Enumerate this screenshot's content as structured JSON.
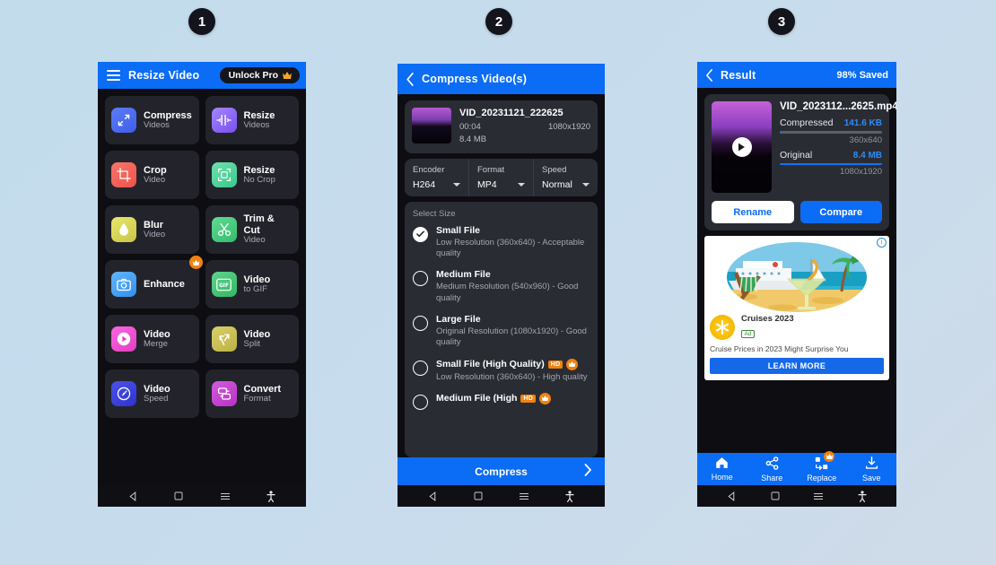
{
  "background": {
    "color_from": "#c2dcec",
    "color_to": "#cfdbe8"
  },
  "steps": [
    {
      "label": "1"
    },
    {
      "label": "2"
    },
    {
      "label": "3"
    }
  ],
  "screen1": {
    "appbar": {
      "title": "Resize Video",
      "menu_icon": "hamburger-icon",
      "unlock_label": "Unlock Pro",
      "crown_icon": "crown-icon"
    },
    "tiles": [
      {
        "title": "Compress",
        "subtitle": "Videos",
        "icon": "compress-arrows-icon",
        "color_from": "#5b7cf7",
        "color_to": "#3f5ee8",
        "pro": false
      },
      {
        "title": "Resize",
        "subtitle": "Videos",
        "icon": "resize-horizontal-icon",
        "color_from": "#a286fb",
        "color_to": "#7b4ff0",
        "pro": false
      },
      {
        "title": "Crop",
        "subtitle": "Video",
        "icon": "crop-icon",
        "color_from": "#f7766b",
        "color_to": "#ef5249",
        "pro": false
      },
      {
        "title": "Resize",
        "subtitle": "No Crop",
        "icon": "expand-frame-icon",
        "color_from": "#6fe0ac",
        "color_to": "#39c98c",
        "pro": false
      },
      {
        "title": "Blur",
        "subtitle": "Video",
        "icon": "droplet-icon",
        "color_from": "#e8e86a",
        "color_to": "#c9c447",
        "pro": false
      },
      {
        "title": "Trim & Cut",
        "subtitle": "Video",
        "icon": "scissors-icon",
        "color_from": "#63d993",
        "color_to": "#32bd6c",
        "pro": false
      },
      {
        "title": "Enhance",
        "subtitle": "",
        "icon": "camera-icon",
        "color_from": "#64b5fb",
        "color_to": "#2f90f0",
        "pro": true
      },
      {
        "title": "Video",
        "subtitle": "to GIF",
        "icon": "gif-icon",
        "color_from": "#5fd48c",
        "color_to": "#2fb865",
        "pro": false
      },
      {
        "title": "Video",
        "subtitle": "Merge",
        "icon": "play-circle-icon",
        "color_from": "#fb66e0",
        "color_to": "#e33fc2",
        "pro": false
      },
      {
        "title": "Video",
        "subtitle": "Split",
        "icon": "split-arrows-icon",
        "color_from": "#d8d06a",
        "color_to": "#bcb144",
        "pro": false
      },
      {
        "title": "Video",
        "subtitle": "Speed",
        "icon": "speedometer-icon",
        "color_from": "#4a52e8",
        "color_to": "#2f33cf",
        "pro": false
      },
      {
        "title": "Convert",
        "subtitle": "Format",
        "icon": "convert-format-icon",
        "color_from": "#d35ae0",
        "color_to": "#b832c4",
        "pro": false
      }
    ],
    "navbar": {
      "back": "back-triangle-icon",
      "home": "home-square-icon",
      "recents": "recents-lines-icon",
      "accessibility": "accessibility-icon"
    }
  },
  "screen2": {
    "appbar": {
      "title": "Compress Video(s)",
      "back_icon": "back-chevron-icon"
    },
    "file": {
      "name": "VID_20231121_222625",
      "duration": "00:04",
      "resolution": "1080x1920",
      "size": "8.4 MB"
    },
    "options": [
      {
        "label": "Encoder",
        "value": "H264"
      },
      {
        "label": "Format",
        "value": "MP4"
      },
      {
        "label": "Speed",
        "value": "Normal"
      }
    ],
    "select_size_label": "Select Size",
    "sizes": [
      {
        "title": "Small File",
        "desc": "Low Resolution (360x640) - Acceptable quality",
        "selected": true,
        "hd": false,
        "pro": false
      },
      {
        "title": "Medium File",
        "desc": "Medium Resolution (540x960) - Good quality",
        "selected": false,
        "hd": false,
        "pro": false
      },
      {
        "title": "Large File",
        "desc": "Original Resolution (1080x1920) - Good quality",
        "selected": false,
        "hd": false,
        "pro": false
      },
      {
        "title": "Small File (High Quality)",
        "desc": "Low Resolution (360x640) - High quality",
        "selected": false,
        "hd": true,
        "pro": true
      },
      {
        "title": "Medium File (High",
        "desc": "",
        "selected": false,
        "hd": true,
        "pro": true
      }
    ],
    "cta": {
      "label": "Compress",
      "chevron": "chevron-right-icon"
    }
  },
  "screen3": {
    "appbar": {
      "title": "Result",
      "saved": "98% Saved",
      "back_icon": "back-chevron-icon"
    },
    "result": {
      "filename": "VID_2023112...2625.mp4",
      "compressed_label": "Compressed",
      "compressed_size": "141.6 KB",
      "compressed_res": "360x640",
      "compressed_pct": 2,
      "original_label": "Original",
      "original_size": "8.4 MB",
      "original_res": "1080x1920",
      "original_pct": 100,
      "play_icon": "play-icon"
    },
    "buttons": [
      {
        "label": "Rename",
        "style": "white"
      },
      {
        "label": "Compare",
        "style": "blue"
      }
    ],
    "ad": {
      "title": "Cruises 2023",
      "badge": "Ad",
      "desc": "Cruise Prices in 2023 Might Surprise You",
      "cta": "LEARN MORE",
      "info_icon": "info-icon"
    },
    "bottomnav": [
      {
        "label": "Home",
        "icon": "home-icon",
        "pro": false
      },
      {
        "label": "Share",
        "icon": "share-icon",
        "pro": false
      },
      {
        "label": "Replace",
        "icon": "replace-icon",
        "pro": true
      },
      {
        "label": "Save",
        "icon": "download-icon",
        "pro": false
      }
    ]
  }
}
